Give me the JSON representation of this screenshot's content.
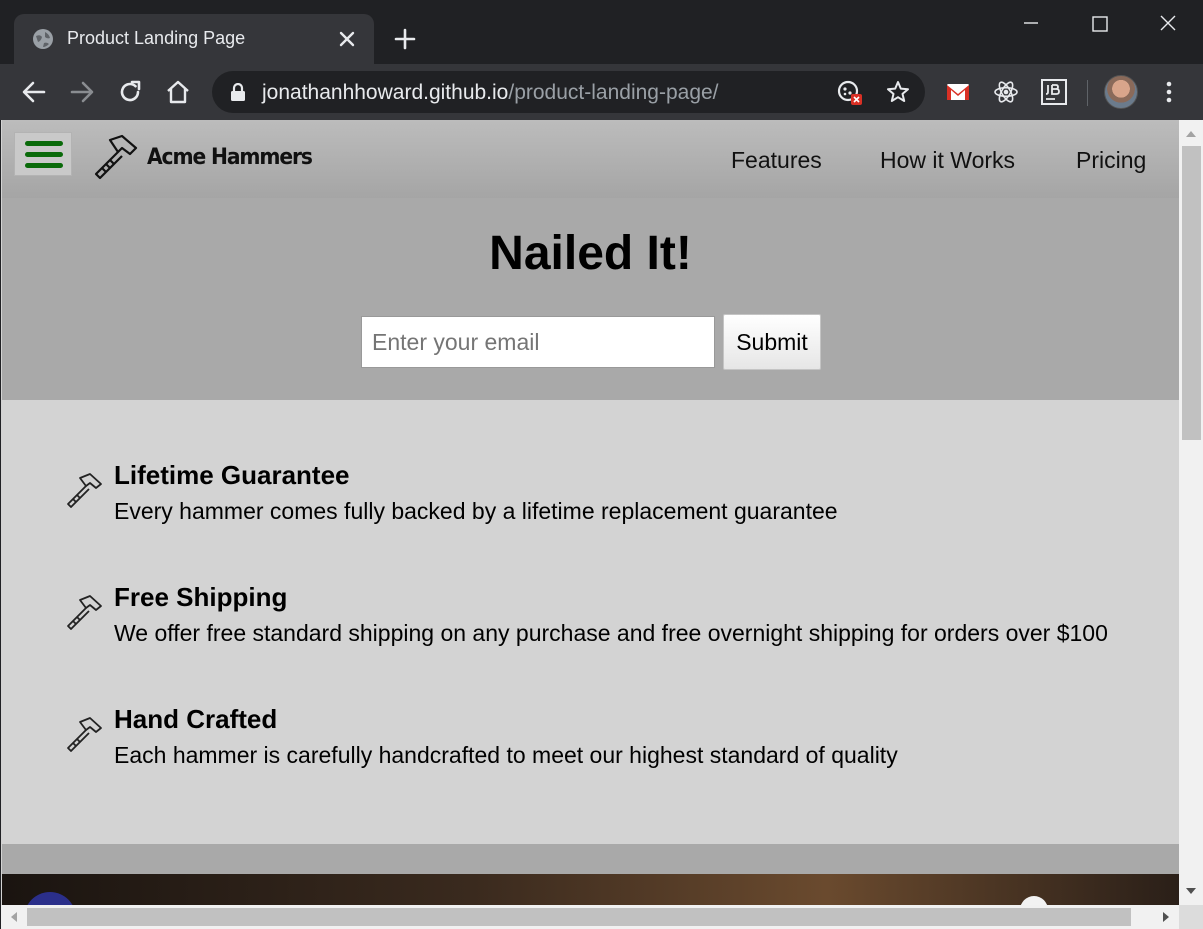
{
  "browser": {
    "tab_title": "Product Landing Page",
    "url_host": "jonathanhhoward.github.io",
    "url_path": "/product-landing-page/"
  },
  "site": {
    "brand": "Acme Hammers",
    "nav": [
      "Features",
      "How it Works",
      "Pricing"
    ],
    "hero_title": "Nailed It!",
    "email_placeholder": "Enter your email",
    "submit_label": "Submit",
    "features": [
      {
        "title": "Lifetime Guarantee",
        "desc": "Every hammer comes fully backed by a lifetime replacement guarantee"
      },
      {
        "title": "Free Shipping",
        "desc": "We offer free standard shipping on any purchase and free overnight shipping for orders over $100"
      },
      {
        "title": "Hand Crafted",
        "desc": "Each hammer is carefully handcrafted to meet our highest standard of quality"
      }
    ]
  },
  "colors": {
    "menu_green": "#0a6a0a",
    "header_gray": "#a9a9a9",
    "features_bg": "#d3d3d3"
  }
}
